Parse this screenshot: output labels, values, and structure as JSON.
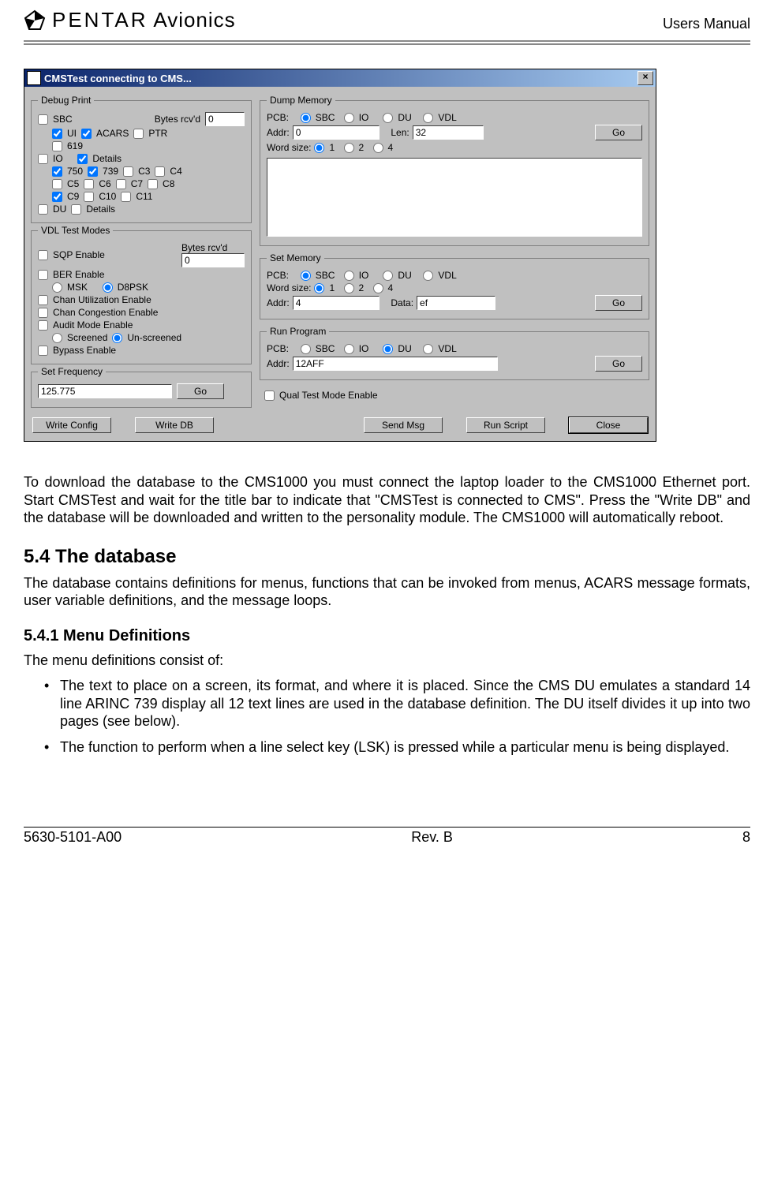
{
  "header": {
    "brand1": "PENTAR",
    "brand2": "Avionics",
    "right": "Users Manual"
  },
  "dialog": {
    "title": "CMSTest connecting to CMS...",
    "close": "×",
    "debug_print": {
      "legend": "Debug Print",
      "bytes_label": "Bytes rcv'd",
      "bytes_value": "0",
      "opts": {
        "sbc": "SBC",
        "ui": "UI",
        "acars": "ACARS",
        "ptr": "PTR",
        "n619": "619",
        "io": "IO",
        "details1": "Details",
        "n750": "750",
        "n739": "739",
        "c3": "C3",
        "c4": "C4",
        "c5": "C5",
        "c6": "C6",
        "c7": "C7",
        "c8": "C8",
        "c9": "C9",
        "c10": "C10",
        "c11": "C11",
        "du": "DU",
        "details2": "Details"
      }
    },
    "vdl": {
      "legend": "VDL Test Modes",
      "bytes_label": "Bytes rcv'd",
      "bytes_value": "0",
      "sqp": "SQP Enable",
      "ber": "BER Enable",
      "msk": "MSK",
      "d8psk": "D8PSK",
      "chan_util": "Chan Utilization Enable",
      "chan_cong": "Chan Congestion Enable",
      "audit": "Audit Mode Enable",
      "screened": "Screened",
      "unscreened": "Un-screened",
      "bypass": "Bypass Enable"
    },
    "set_freq": {
      "legend": "Set Frequency",
      "value": "125.775",
      "go": "Go"
    },
    "dump_mem": {
      "legend": "Dump Memory",
      "pcb": "PCB:",
      "sbc": "SBC",
      "io": "IO",
      "du": "DU",
      "vdl": "VDL",
      "addr": "Addr:",
      "addr_val": "0",
      "len": "Len:",
      "len_val": "32",
      "go": "Go",
      "word": "Word size:",
      "w1": "1",
      "w2": "2",
      "w4": "4"
    },
    "set_mem": {
      "legend": "Set Memory",
      "pcb": "PCB:",
      "sbc": "SBC",
      "io": "IO",
      "du": "DU",
      "vdl": "VDL",
      "word": "Word size:",
      "w1": "1",
      "w2": "2",
      "w4": "4",
      "addr": "Addr:",
      "addr_val": "4",
      "data": "Data:",
      "data_val": "ef",
      "go": "Go"
    },
    "run_prog": {
      "legend": "Run Program",
      "pcb": "PCB:",
      "sbc": "SBC",
      "io": "IO",
      "du": "DU",
      "vdl": "VDL",
      "addr": "Addr:",
      "addr_val": "12AFF",
      "go": "Go"
    },
    "qual": "Qual Test Mode Enable",
    "buttons": {
      "write_config": "Write Config",
      "write_db": "Write DB",
      "send_msg": "Send Msg",
      "run_script": "Run Script",
      "close": "Close"
    }
  },
  "para1": "To download the database to the CMS1000 you must connect the laptop loader to the CMS1000 Ethernet port.  Start CMSTest and wait for the title bar to indicate that \"CMSTest is connected to CMS\".  Press the \"Write DB\" and the database will be downloaded and written to the personality module.  The CMS1000 will automatically reboot.",
  "h54": "5.4   The database",
  "para2": "The database contains definitions for menus, functions that can be invoked from menus, ACARS message formats, user variable definitions, and the message loops.",
  "h541": "5.4.1   Menu Definitions",
  "para3": "The menu definitions consist of:",
  "bullets": [
    "The text to place on a screen, its format, and where it is placed.  Since the CMS DU emulates a standard 14 line ARINC 739 display all 12 text lines are used in the database definition.  The DU itself divides it up into two pages (see below).",
    "The function to perform when a line select key (LSK) is pressed while a particular menu is being displayed."
  ],
  "footer": {
    "left": "5630-5101-A00",
    "center": "Rev. B",
    "right": "8"
  }
}
